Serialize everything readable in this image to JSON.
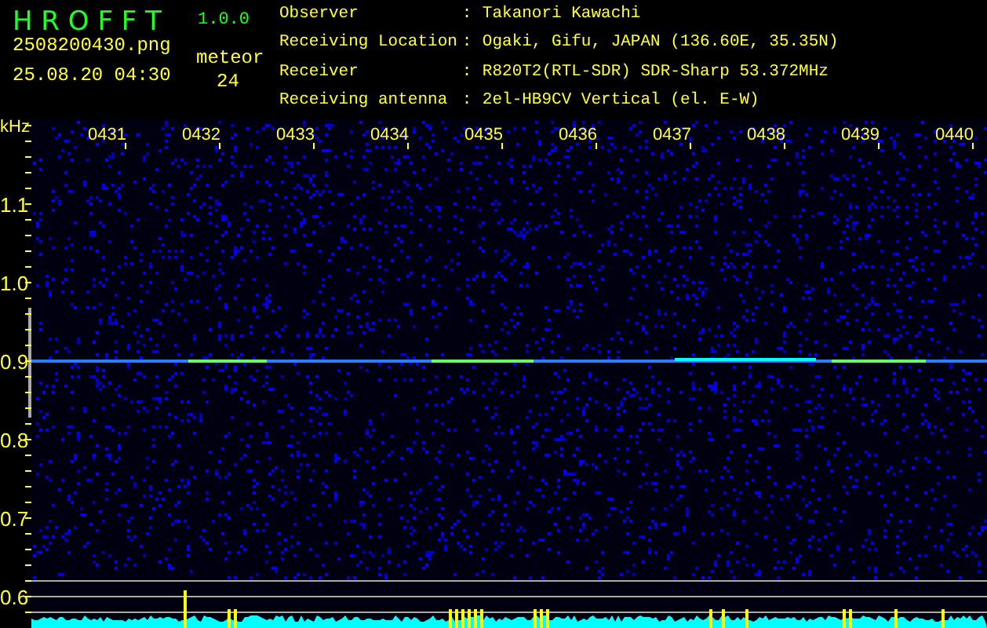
{
  "app": {
    "title": "H R O F F T",
    "version": "1.0.0"
  },
  "file_name": "2508200430.png",
  "timestamp": "25.08.20 04:30",
  "meteor": {
    "label": "meteor",
    "count": "24"
  },
  "info": [
    {
      "label": "Observer",
      "separator": ":",
      "value": "Takanori Kawachi"
    },
    {
      "label": "Receiving Location",
      "separator": ":",
      "value": "Ogaki, Gifu, JAPAN (136.60E, 35.35N)"
    },
    {
      "label": "Receiver",
      "separator": ":",
      "value": "R820T2(RTL-SDR) SDR-Sharp 53.372MHz"
    },
    {
      "label": "Receiving antenna",
      "separator": ":",
      "value": "2el-HB9CV Vertical (el. E-W)"
    }
  ],
  "spectrogram": {
    "unit": "kHz",
    "time_labels": [
      "0431",
      "0432",
      "0433",
      "0434",
      "0435",
      "0436",
      "0437",
      "0438",
      "0439",
      "0440"
    ],
    "freq_labels": [
      "1.1",
      "1.0",
      "0.9",
      "0.8",
      "0.7",
      "0.6"
    ]
  }
}
